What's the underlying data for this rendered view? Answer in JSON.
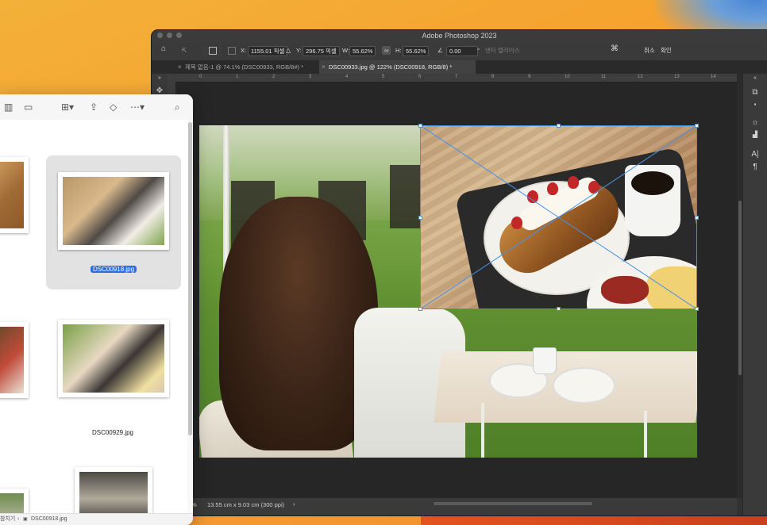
{
  "photoshop": {
    "app_title": "Adobe Photoshop 2023",
    "options": {
      "x_label": "X:",
      "x_value": "1155.01 픽셀",
      "y_label": "Y:",
      "y_value": "296.75 픽셀",
      "w_label": "W:",
      "w_value": "55.62%",
      "h_label": "H:",
      "h_value": "55.62%",
      "angle_value": "0.00",
      "degree": "°",
      "interpolation": "앤티 앨리어스",
      "cancel": "취소",
      "commit": "확인"
    },
    "tabs": [
      {
        "label": "제목 없음-1 @ 74.1% (DSC00933, RGB/8#) *",
        "active": false
      },
      {
        "label": "DSC00933.jpg @ 122% (DSC00918, RGB/8) *",
        "active": true
      }
    ],
    "ruler_ticks": [
      "0",
      "1",
      "2",
      "3",
      "4",
      "5",
      "6",
      "7",
      "8",
      "9",
      "10",
      "11",
      "12",
      "13",
      "14"
    ],
    "status": {
      "zoom": "%",
      "doc_size": "13.55 cm x 9.03 cm (300 ppi)",
      "arrow": "›"
    }
  },
  "finder": {
    "files": [
      {
        "name": "DSC00918.jpg",
        "selected": true
      },
      {
        "name": "DSC00929.jpg",
        "selected": false
      }
    ],
    "path": {
      "parent": "참치기",
      "separator": "›",
      "file": "DSC00918.jpg"
    }
  },
  "icons": {
    "columns_view": "columns-view-icon",
    "gallery_view": "gallery-view-icon",
    "group": "group-icon",
    "share": "share-icon",
    "tag": "tag-icon",
    "more": "more-icon",
    "search": "search-icon"
  },
  "colors": {
    "selection_blue": "#2b6de0",
    "transform_box": "#4a90e2",
    "ps_background": "#323232"
  }
}
